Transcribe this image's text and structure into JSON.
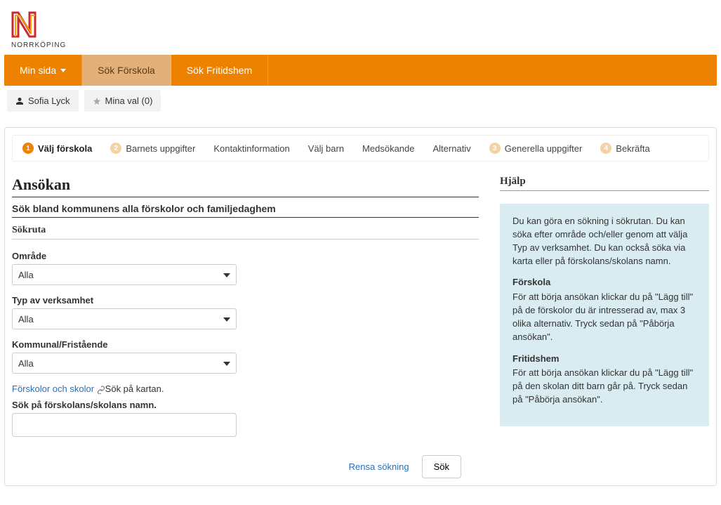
{
  "brand": {
    "name": "NORRKÖPING"
  },
  "nav": {
    "items": [
      {
        "label": "Min sida",
        "active": false,
        "has_caret": true
      },
      {
        "label": "Sök Förskola",
        "active": true,
        "has_caret": false
      },
      {
        "label": "Sök Fritidshem",
        "active": false,
        "has_caret": false
      }
    ]
  },
  "subnav": {
    "user": "Sofia Lyck",
    "favorites": "Mina val (0)"
  },
  "steps": [
    {
      "n": "1",
      "label": "Välj förskola",
      "state": "active"
    },
    {
      "n": "2",
      "label": "Barnets uppgifter",
      "state": "pale"
    },
    {
      "n": "",
      "label": "Kontaktinformation",
      "state": "plain"
    },
    {
      "n": "",
      "label": "Välj barn",
      "state": "plain"
    },
    {
      "n": "",
      "label": "Medsökande",
      "state": "plain"
    },
    {
      "n": "",
      "label": "Alternativ",
      "state": "plain"
    },
    {
      "n": "3",
      "label": "Generella uppgifter",
      "state": "pale"
    },
    {
      "n": "4",
      "label": "Bekräfta",
      "state": "pale"
    }
  ],
  "main": {
    "title": "Ansökan",
    "subtitle": "Sök bland kommunens alla förskolor och familjedaghem",
    "panel_title": "Sökruta",
    "form": {
      "omrade_label": "Område",
      "omrade_value": "Alla",
      "typ_label": "Typ av verksamhet",
      "typ_value": "Alla",
      "kommunal_label": "Kommunal/Fristående",
      "kommunal_value": "Alla",
      "link_map_prefix": "Förskolor och skolor",
      "link_map_suffix": "Sök på kartan.",
      "name_search_label": "Sök på förskolans/skolans namn.",
      "name_search_value": ""
    },
    "actions": {
      "clear": "Rensa sökning",
      "search": "Sök"
    }
  },
  "side": {
    "title": "Hjälp",
    "help_intro": "Du kan göra en sökning i sökrutan. Du kan söka efter område och/eller genom att välja Typ av verksamhet. Du kan också söka via karta eller på förskolans/skolans namn.",
    "forskola_h": "Förskola",
    "forskola_p": "För att börja ansökan klickar du på \"Lägg till\" på de förskolor du är intresserad av, max 3 olika alternativ. Tryck sedan på \"Påbörja ansökan\".",
    "fritids_h": "Fritidshem",
    "fritids_p": "För att börja ansökan klickar du på \"Lägg till\" på den skolan ditt barn går på. Tryck sedan på \"Påbörja ansökan\"."
  }
}
